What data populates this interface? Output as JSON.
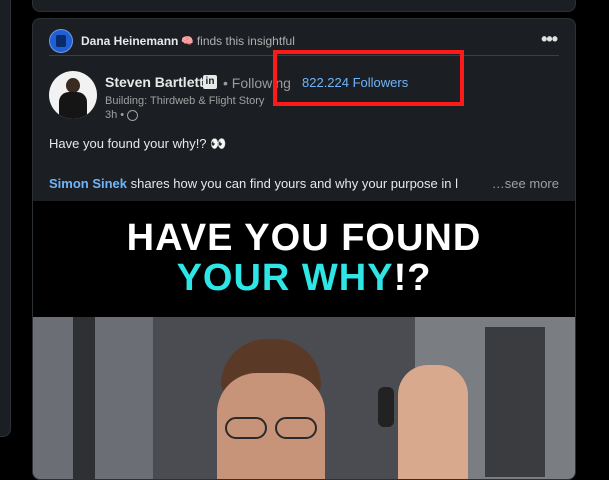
{
  "social": {
    "name": "Dana Heinemann",
    "emoji": "🧠",
    "action": "finds this insightful",
    "more_label": "•••"
  },
  "author": {
    "name": "Steven Bartlett",
    "badge": "in",
    "following": "• Following",
    "followers": "822.224 Followers",
    "headline": "Building: Thirdweb & Flight Story",
    "time": "3h •"
  },
  "post": {
    "text": "Have you found your why!? 👀",
    "mention": "Simon Sinek",
    "text2": " shares how you can find yours and why your purpose in l",
    "see_more": "…see more"
  },
  "media": {
    "line1": "HAVE YOU FOUND",
    "line2_accent": "YOUR WHY",
    "line2_tail": "!?"
  },
  "colors": {
    "accent": "#70b5f9",
    "highlight": "#ff1a1a",
    "media_accent": "#2ee6e6"
  }
}
